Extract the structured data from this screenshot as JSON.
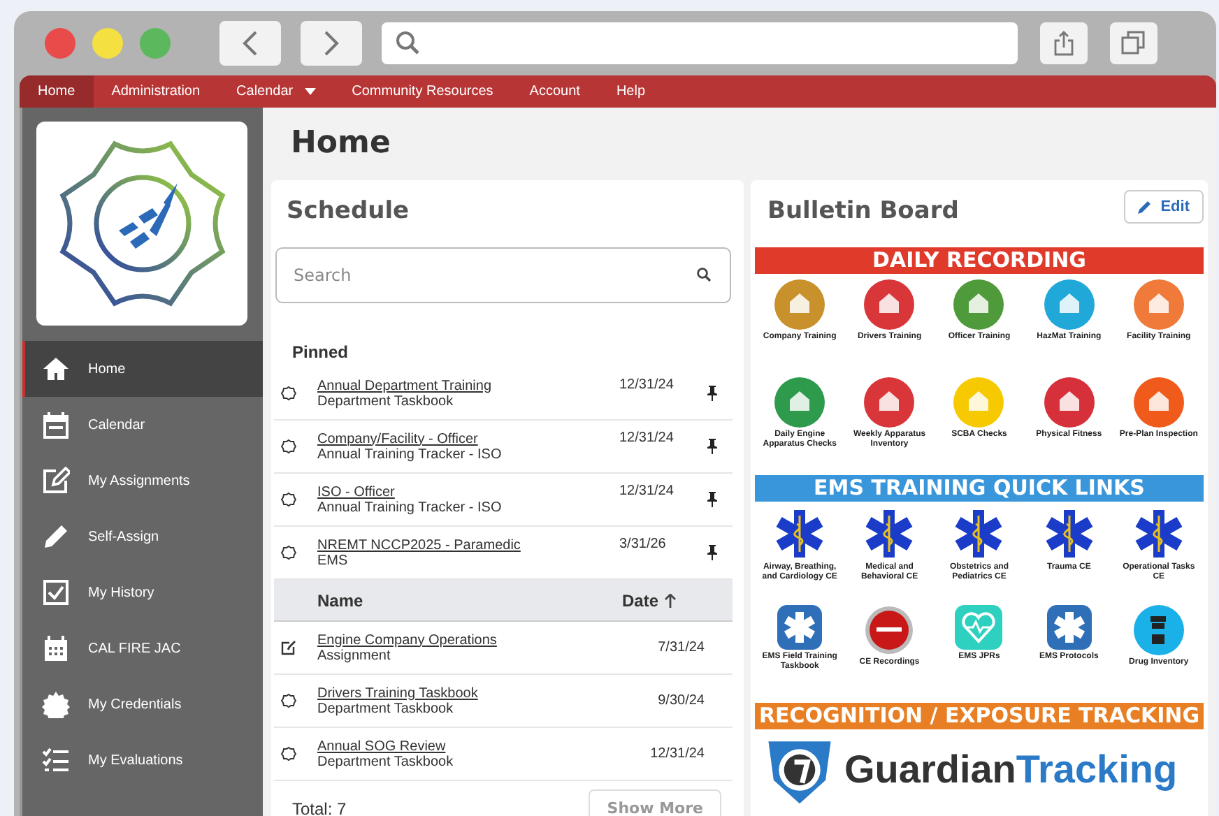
{
  "nav": [
    {
      "label": "Home",
      "selected": true,
      "dropdown": false
    },
    {
      "label": "Administration",
      "selected": false,
      "dropdown": false
    },
    {
      "label": "Calendar",
      "selected": false,
      "dropdown": true
    },
    {
      "label": "Community Resources",
      "selected": false,
      "dropdown": false
    },
    {
      "label": "Account",
      "selected": false,
      "dropdown": false
    },
    {
      "label": "Help",
      "selected": false,
      "dropdown": false
    }
  ],
  "sidebar": {
    "items": [
      {
        "kind": "home",
        "label": "Home",
        "selected": true
      },
      {
        "kind": "calendar",
        "label": "Calendar",
        "selected": false
      },
      {
        "kind": "assignments",
        "label": "My Assignments",
        "selected": false
      },
      {
        "kind": "pencil",
        "label": "Self-Assign",
        "selected": false
      },
      {
        "kind": "history",
        "label": "My History",
        "selected": false
      },
      {
        "kind": "grid-calendar",
        "label": "CAL FIRE JAC",
        "selected": false
      },
      {
        "kind": "credentials",
        "label": "My Credentials",
        "selected": false
      },
      {
        "kind": "evaluations",
        "label": "My Evaluations",
        "selected": false
      }
    ]
  },
  "page_title": "Home",
  "schedule": {
    "title": "Schedule",
    "search": {
      "placeholder": "Search"
    },
    "pinned_heading": "Pinned",
    "pinned": [
      {
        "kind": "taskbook",
        "title": "Annual Department Training",
        "subtitle": "Department Taskbook",
        "date": "12/31/24"
      },
      {
        "kind": "taskbook",
        "title": "Company/Facility - Officer",
        "subtitle": "Annual Training Tracker - ISO",
        "date": "12/31/24"
      },
      {
        "kind": "taskbook",
        "title": "ISO - Officer",
        "subtitle": "Annual Training Tracker - ISO",
        "date": "12/31/24"
      },
      {
        "kind": "taskbook",
        "title": "NREMT NCCP2025 - Paramedic",
        "subtitle": "EMS",
        "date": "3/31/26"
      }
    ],
    "columns": [
      "Name",
      "Date"
    ],
    "rows": [
      {
        "kind": "assignment",
        "title": "Engine Company Operations",
        "subtitle": "Assignment",
        "date": "7/31/24"
      },
      {
        "kind": "taskbook",
        "title": "Drivers Training Taskbook",
        "subtitle": "Department Taskbook",
        "date": "9/30/24"
      },
      {
        "kind": "taskbook",
        "title": "Annual SOG Review",
        "subtitle": "Department Taskbook",
        "date": "12/31/24"
      }
    ],
    "total": "Total: 7",
    "show_more": "Show More"
  },
  "bulletin": {
    "title": "Bulletin Board",
    "edit_button": "Edit",
    "sections": [
      {
        "heading": "DAILY RECORDING",
        "color": "#e03a2b",
        "tiles": [
          {
            "kind": "circle",
            "color": "#c9912c",
            "label": "Company Training"
          },
          {
            "kind": "circle",
            "color": "#d9363a",
            "label": "Drivers Training"
          },
          {
            "kind": "circle",
            "color": "#4f9a3a",
            "label": "Officer Training"
          },
          {
            "kind": "circle",
            "color": "#1fa8d8",
            "label": "HazMat Training"
          },
          {
            "kind": "circle",
            "color": "#f07a3a",
            "label": "Facility Training"
          },
          {
            "kind": "circle",
            "color": "#2e9a4c",
            "label": "Daily Engine Apparatus Checks"
          },
          {
            "kind": "circle",
            "color": "#d9363a",
            "label": "Weekly Apparatus Inventory"
          },
          {
            "kind": "circle",
            "color": "#f7c900",
            "label": "SCBA Checks"
          },
          {
            "kind": "circle",
            "color": "#d6303a",
            "label": "Physical Fitness"
          },
          {
            "kind": "circle",
            "color": "#f05a1a",
            "label": "Pre-Plan Inspection"
          }
        ]
      },
      {
        "heading": "EMS TRAINING QUICK LINKS",
        "color": "#3a96db",
        "tiles": [
          {
            "kind": "star",
            "label": "Airway, Breathing, and Cardiology CE"
          },
          {
            "kind": "star",
            "label": "Medical and Behavioral CE"
          },
          {
            "kind": "star",
            "label": "Obstetrics and Pediatrics CE"
          },
          {
            "kind": "star",
            "label": "Trauma CE"
          },
          {
            "kind": "star",
            "label": "Operational Tasks CE"
          },
          {
            "kind": "star-tile",
            "label": "EMS Field Training Taskbook"
          },
          {
            "kind": "rec",
            "label": "CE Recordings"
          },
          {
            "kind": "heart",
            "label": "EMS JPRs"
          },
          {
            "kind": "star-tile",
            "label": "EMS Protocols"
          },
          {
            "kind": "bottle",
            "label": "Drug Inventory"
          }
        ]
      },
      {
        "heading": "RECOGNITION / EXPOSURE TRACKING",
        "color": "#e87f24",
        "logo": {
          "part_1": "Guardian",
          "part_2": "Tracking"
        }
      }
    ]
  }
}
